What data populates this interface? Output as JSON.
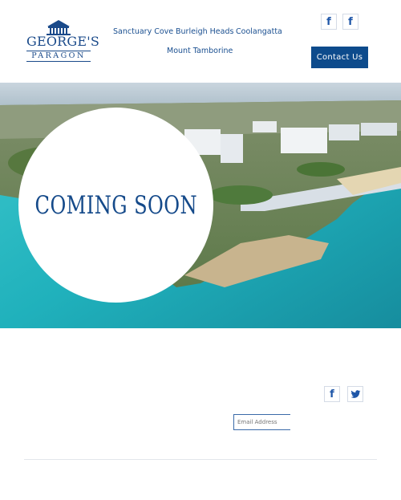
{
  "brand": {
    "name_line1": "GEORGE'S",
    "name_line2": "PARAGON"
  },
  "nav": {
    "items": [
      {
        "label": "Sanctuary Cove"
      },
      {
        "label": "Burleigh Heads"
      },
      {
        "label": "Coolangatta"
      },
      {
        "label": "Mount Tamborine"
      }
    ]
  },
  "header": {
    "social_icons": [
      "facebook-icon",
      "facebook-icon"
    ],
    "social_glyphs": [
      "f",
      "f"
    ],
    "contact_label": "Contact Us"
  },
  "hero": {
    "headline": "COMING SOON"
  },
  "footer": {
    "social_icons": [
      "facebook-icon",
      "twitter-icon"
    ],
    "social_glyphs": [
      "f",
      "t"
    ],
    "email_placeholder": "Email Address"
  },
  "colors": {
    "brand_blue": "#0d4b8c",
    "nav_text": "#1a4f90",
    "sea": "#28b9c0"
  }
}
